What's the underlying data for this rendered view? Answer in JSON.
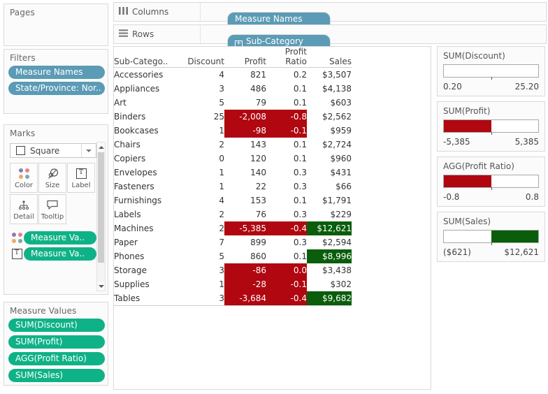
{
  "sidebar": {
    "pages": {
      "title": "Pages"
    },
    "filters": {
      "title": "Filters",
      "pills": [
        {
          "label": "Measure Names",
          "color": "#5b9bb5"
        },
        {
          "label": "State/Province: Nor..",
          "color": "#5b9bb5"
        }
      ]
    },
    "marks": {
      "title": "Marks",
      "mark_type": "Square",
      "dropdown_icon": "chevron-down-icon",
      "buttons": [
        {
          "label": "Color",
          "icon": "color-dots-icon"
        },
        {
          "label": "Size",
          "icon": "size-circles-icon"
        },
        {
          "label": "Label",
          "icon": "label-text-icon"
        },
        {
          "label": "Detail",
          "icon": "detail-hierarchy-icon"
        },
        {
          "label": "Tooltip",
          "icon": "tooltip-bubble-icon"
        }
      ],
      "shelf_pills": [
        {
          "icon": "color-dots-icon",
          "label": "Measure Va..",
          "color": "#0fb286"
        },
        {
          "icon": "label-text-icon",
          "label": "Measure Va..",
          "color": "#0fb286"
        }
      ],
      "scrollbar": {
        "up": "chevron-up-icon",
        "down": "chevron-down-icon"
      }
    },
    "measure_values": {
      "title": "Measure Values",
      "pills": [
        {
          "label": "SUM(Discount)",
          "color": "#0fb286"
        },
        {
          "label": "SUM(Profit)",
          "color": "#0fb286"
        },
        {
          "label": "AGG(Profit Ratio)",
          "color": "#0fb286"
        },
        {
          "label": "SUM(Sales)",
          "color": "#0fb286"
        }
      ]
    }
  },
  "shelves": {
    "columns": {
      "label": "Columns",
      "icon": "columns-icon",
      "pill": "Measure Names"
    },
    "rows": {
      "label": "Rows",
      "icon": "rows-icon",
      "pill": "Sub-Category",
      "pill_prefix": "+"
    }
  },
  "chart_data": {
    "type": "table",
    "title": "",
    "columns": [
      {
        "key": "subcategory",
        "header": "Sub-Catego..",
        "align": "left"
      },
      {
        "key": "discount",
        "header": "Discount",
        "align": "right"
      },
      {
        "key": "profit",
        "header": "Profit",
        "align": "right"
      },
      {
        "key": "profit_ratio",
        "header_line1": "Profit",
        "header": "Ratio",
        "align": "right"
      },
      {
        "key": "sales",
        "header": "Sales",
        "align": "right"
      }
    ],
    "rows": [
      {
        "subcategory": "Accessories",
        "discount": "4",
        "profit": "821",
        "profit_ratio": "0.2",
        "sales": "$3,507",
        "profit_hl": "none",
        "ratio_hl": "none",
        "sales_hl": "none"
      },
      {
        "subcategory": "Appliances",
        "discount": "3",
        "profit": "486",
        "profit_ratio": "0.1",
        "sales": "$4,138",
        "profit_hl": "none",
        "ratio_hl": "none",
        "sales_hl": "none"
      },
      {
        "subcategory": "Art",
        "discount": "5",
        "profit": "79",
        "profit_ratio": "0.1",
        "sales": "$603",
        "profit_hl": "none",
        "ratio_hl": "none",
        "sales_hl": "none"
      },
      {
        "subcategory": "Binders",
        "discount": "25",
        "profit": "-2,008",
        "profit_ratio": "-0.8",
        "sales": "$2,562",
        "profit_hl": "neg",
        "ratio_hl": "neg",
        "sales_hl": "none"
      },
      {
        "subcategory": "Bookcases",
        "discount": "1",
        "profit": "-98",
        "profit_ratio": "-0.1",
        "sales": "$959",
        "profit_hl": "neg",
        "ratio_hl": "neg",
        "sales_hl": "none"
      },
      {
        "subcategory": "Chairs",
        "discount": "2",
        "profit": "143",
        "profit_ratio": "0.1",
        "sales": "$2,724",
        "profit_hl": "none",
        "ratio_hl": "none",
        "sales_hl": "none"
      },
      {
        "subcategory": "Copiers",
        "discount": "0",
        "profit": "120",
        "profit_ratio": "0.1",
        "sales": "$960",
        "profit_hl": "none",
        "ratio_hl": "none",
        "sales_hl": "none"
      },
      {
        "subcategory": "Envelopes",
        "discount": "1",
        "profit": "140",
        "profit_ratio": "0.3",
        "sales": "$431",
        "profit_hl": "none",
        "ratio_hl": "none",
        "sales_hl": "none"
      },
      {
        "subcategory": "Fasteners",
        "discount": "1",
        "profit": "22",
        "profit_ratio": "0.3",
        "sales": "$66",
        "profit_hl": "none",
        "ratio_hl": "none",
        "sales_hl": "none"
      },
      {
        "subcategory": "Furnishings",
        "discount": "4",
        "profit": "153",
        "profit_ratio": "0.1",
        "sales": "$1,791",
        "profit_hl": "none",
        "ratio_hl": "none",
        "sales_hl": "none"
      },
      {
        "subcategory": "Labels",
        "discount": "2",
        "profit": "76",
        "profit_ratio": "0.3",
        "sales": "$229",
        "profit_hl": "none",
        "ratio_hl": "none",
        "sales_hl": "none"
      },
      {
        "subcategory": "Machines",
        "discount": "2",
        "profit": "-5,385",
        "profit_ratio": "-0.4",
        "sales": "$12,621",
        "profit_hl": "neg",
        "ratio_hl": "neg",
        "sales_hl": "pos"
      },
      {
        "subcategory": "Paper",
        "discount": "7",
        "profit": "899",
        "profit_ratio": "0.3",
        "sales": "$2,594",
        "profit_hl": "none",
        "ratio_hl": "none",
        "sales_hl": "none"
      },
      {
        "subcategory": "Phones",
        "discount": "5",
        "profit": "860",
        "profit_ratio": "0.1",
        "sales": "$8,996",
        "profit_hl": "none",
        "ratio_hl": "none",
        "sales_hl": "pos"
      },
      {
        "subcategory": "Storage",
        "discount": "3",
        "profit": "-86",
        "profit_ratio": "0.0",
        "sales": "$3,438",
        "profit_hl": "neg",
        "ratio_hl": "neg",
        "sales_hl": "none"
      },
      {
        "subcategory": "Supplies",
        "discount": "1",
        "profit": "-28",
        "profit_ratio": "-0.1",
        "sales": "$302",
        "profit_hl": "neg",
        "ratio_hl": "neg",
        "sales_hl": "none"
      },
      {
        "subcategory": "Tables",
        "discount": "3",
        "profit": "-3,684",
        "profit_ratio": "-0.4",
        "sales": "$9,682",
        "profit_hl": "neg",
        "ratio_hl": "neg",
        "sales_hl": "pos"
      }
    ],
    "colors": {
      "negative": "#b00711",
      "positive": "#0a5d0b",
      "text": "#333333"
    }
  },
  "legends": [
    {
      "title": "SUM(Discount)",
      "min": "0.20",
      "max": "25.20",
      "fill": "none",
      "fill_pct": 0,
      "tick_pct": 50
    },
    {
      "title": "SUM(Profit)",
      "min": "-5,385",
      "max": "5,385",
      "fill": "neg",
      "fill_pct": 50,
      "tick_pct": 50
    },
    {
      "title": "AGG(Profit Ratio)",
      "min": "-0.8",
      "max": "0.8",
      "fill": "neg",
      "fill_pct": 50,
      "tick_pct": 50
    },
    {
      "title": "SUM(Sales)",
      "min": "($621)",
      "max": "$12,621",
      "fill": "pos",
      "fill_pct": 50,
      "tick_pct": 50
    }
  ]
}
